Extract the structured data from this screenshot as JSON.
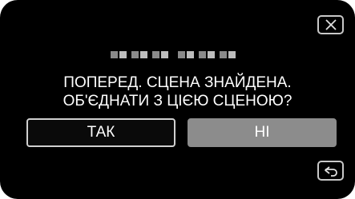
{
  "dialog": {
    "message_line1": "ПОПЕРЕД. СЦЕНА ЗНАЙДЕНА.",
    "message_line2": "ОБ'ЄДНАТИ З ЦІЄЮ СЦЕНОЮ?",
    "yes_label": "ТАК",
    "no_label": "НІ",
    "selected": "НІ"
  },
  "icons": {
    "close": "close-icon",
    "back": "back-arrow-icon"
  },
  "colors": {
    "background": "#000000",
    "text": "#ffffff",
    "selected_button": "#8c8c8c",
    "button_border": "#d0d0d0"
  }
}
